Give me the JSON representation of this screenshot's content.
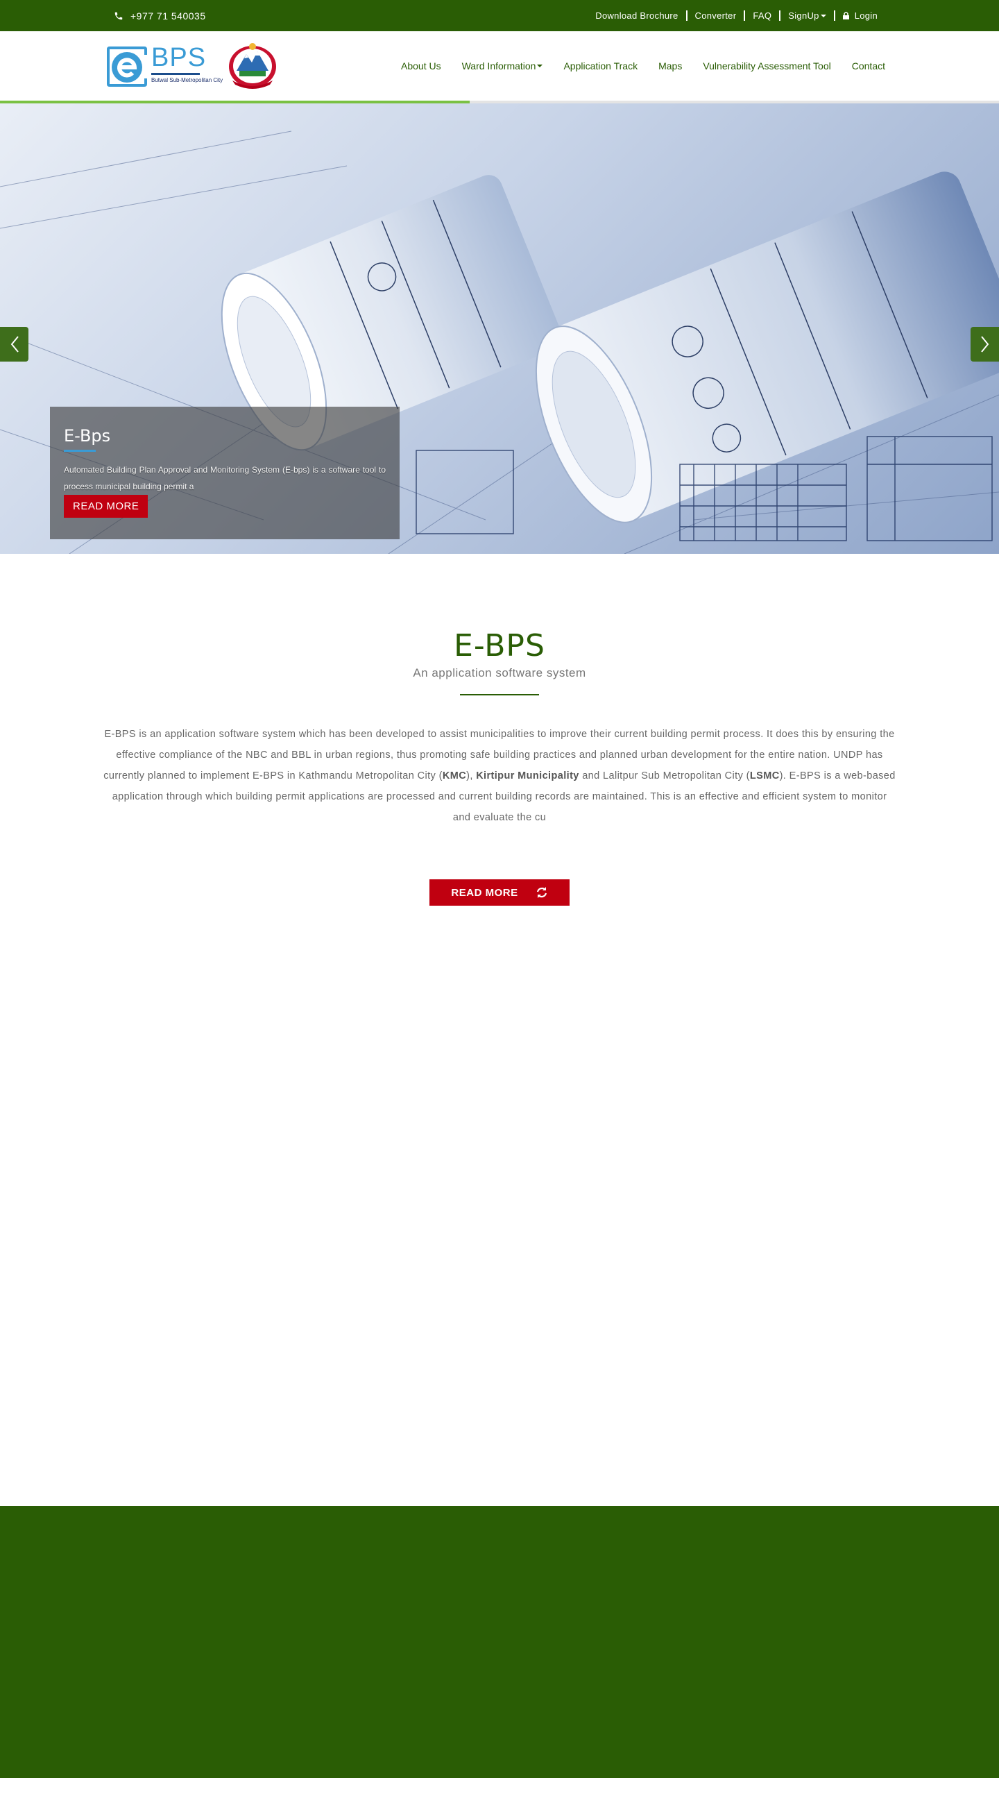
{
  "topbar": {
    "phone": "+977 71 540035",
    "links": [
      "Download Brochure",
      "Converter",
      "FAQ",
      "SignUp",
      "Login"
    ]
  },
  "header": {
    "logo_text": "BPS",
    "logo_subtitle": "Butwal Sub-Metropolitan City",
    "nav": [
      "About Us",
      "Ward Information",
      "Application Track",
      "Maps",
      "Vulnerability Assessment Tool",
      "Contact"
    ]
  },
  "slider": {
    "progress": 0.47,
    "caption_title": "E-Bps",
    "caption_text": "Automated Building Plan Approval and Monitoring System (E-bps) is a software tool to process municipal building permit a",
    "caption_button": "READ MORE"
  },
  "about": {
    "title": "E-BPS",
    "subtitle": "An application software system",
    "body_1": "E-BPS is an application software system which has been developed to assist municipalities to improve their current building permit process.  It does this by ensuring the effective compliance of the NBC and BBL in urban regions, thus promoting safe building practices and planned urban development for the entire nation. UNDP has currently planned to implement E-BPS in Kathmandu Metropolitan City (",
    "kmc": "KMC",
    "body_2": "), ",
    "kirtipur": "Kirtipur Municipality",
    "body_3": " and Lalitpur Sub Metropolitan City (",
    "lsmc": "LSMC",
    "body_4": ").   E-BPS is a web-based application through which building permit applications are processed and current building records are maintained. This is an effective and efficient system to monitor and evaluate the cu",
    "button": "READ MORE"
  },
  "colors": {
    "brand_green": "#2a5d05",
    "accent_red": "#c00010",
    "accent_blue": "#3a9bd5"
  }
}
